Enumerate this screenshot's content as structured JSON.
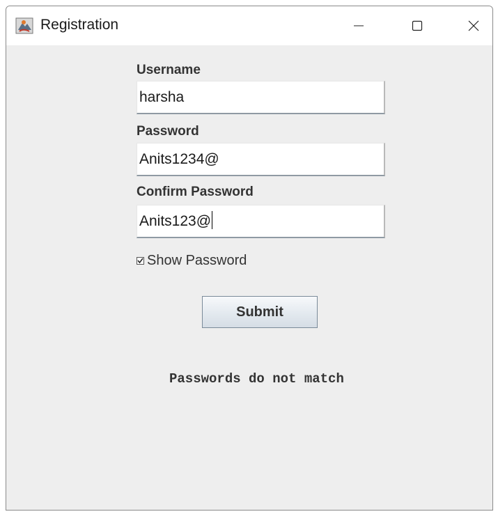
{
  "window": {
    "title": "Registration",
    "icon": "java-app-icon"
  },
  "form": {
    "username_label": "Username",
    "username_value": "harsha",
    "password_label": "Password",
    "password_value": "Anits1234@",
    "confirm_label": "Confirm Password",
    "confirm_value": "Anits123@",
    "show_password_label": "Show Password",
    "show_password_checked": true,
    "submit_label": "Submit"
  },
  "status": {
    "message": "Passwords do not match"
  }
}
